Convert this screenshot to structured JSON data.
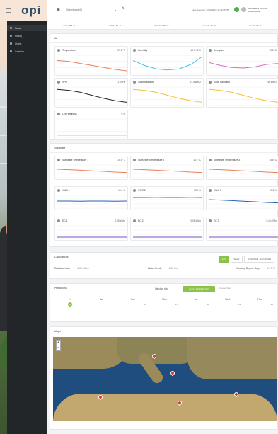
{
  "brand": {
    "name": "opi"
  },
  "sidebar": {
    "items": [
      {
        "label": "Home"
      },
      {
        "label": "History"
      },
      {
        "label": "Charts"
      },
      {
        "label": "Calendar"
      }
    ]
  },
  "topbar": {
    "location": "Greenhouse 01",
    "last_update": "Last detection: 17/10/2023 11:19:05 PM",
    "user": "Alessandra Bonomi",
    "role": "Greenhouse"
  },
  "weather": [
    {
      "day": "Mon",
      "temp": "10/4 °C"
    },
    {
      "day": "Tue",
      "temp": "9 / 14 °C"
    },
    {
      "day": "Wed",
      "temp": "16 / 10 °C"
    },
    {
      "day": "Thu",
      "temp": "15 / 13 °C"
    },
    {
      "day": "Fri",
      "temp": "14 / 11 °C"
    }
  ],
  "air": {
    "title": "Air",
    "cards": [
      {
        "label": "Temperature",
        "value": "21.6 °C",
        "color": "#e8825a"
      },
      {
        "label": "Humidity",
        "value": "48.9 %RH",
        "color": "#49c2e0"
      },
      {
        "label": "Dew point",
        "value": "15.6 °C",
        "color": "#d96ac1"
      },
      {
        "label": "VPD",
        "value": "1.5 kPa",
        "color": "#222222"
      },
      {
        "label": "Solar Radiation",
        "value": "21.5 W/m2",
        "color": "#f0c23a"
      },
      {
        "label": "Solar Radiation",
        "value": "46 W/m2",
        "color": "#f0c23a"
      },
      {
        "label": "Leaf Wetness",
        "value": "0 %",
        "color": "#4cbb63"
      }
    ]
  },
  "substrate": {
    "title": "Substrate",
    "cards": [
      {
        "label": "Substrate Temperature 1",
        "value": "15.5 °C",
        "color": "#e8825a"
      },
      {
        "label": "Substrate Temperature 2",
        "value": "16.2 °C",
        "color": "#e8825a"
      },
      {
        "label": "Substrate Temperature 3",
        "value": "15.5 °C",
        "color": "#e8825a"
      },
      {
        "label": "VWC 1",
        "value": "19.9 %",
        "color": "#2a5fb0"
      },
      {
        "label": "VWC 2",
        "value": "33.7 %",
        "color": "#2a5fb0"
      },
      {
        "label": "VWC 3",
        "value": "26.3 %",
        "color": "#2a5fb0"
      },
      {
        "label": "EC 1",
        "value": "0.05 dS/m",
        "color": "#7a4fc9"
      },
      {
        "label": "EC 2",
        "value": "0.05 dS/m",
        "color": "#7a4fc9"
      },
      {
        "label": "EC 3",
        "value": "0.16 dS/m",
        "color": "#7a4fc9"
      }
    ]
  },
  "calculations": {
    "title": "Calculations",
    "tabs": [
      "24h",
      "Week",
      "17/10/2023 - 18/10/2023"
    ],
    "items": [
      {
        "label": "Radiation Sum",
        "value": "6.03 MJ/m²"
      },
      {
        "label": "Water Needs",
        "value": "1.35 l/m²"
      },
      {
        "label": "Growing Degree Days",
        "value": "9.47 °C"
      }
    ]
  },
  "predictions": {
    "title": "Predictions",
    "risk_label": "Infection risk",
    "button": "DISEASE REPORT",
    "select_placeholder": "Disease filter",
    "days": [
      {
        "d": "Fri",
        "n": "18"
      },
      {
        "d": "Sat",
        "n": ""
      },
      {
        "d": "Sun",
        "n": "26"
      },
      {
        "d": "Mon",
        "n": "27"
      },
      {
        "d": "Tue",
        "n": "28"
      },
      {
        "d": "Wed",
        "n": "21"
      },
      {
        "d": "Thu",
        "n": "22"
      }
    ]
  },
  "maps": {
    "title": "Maps"
  }
}
